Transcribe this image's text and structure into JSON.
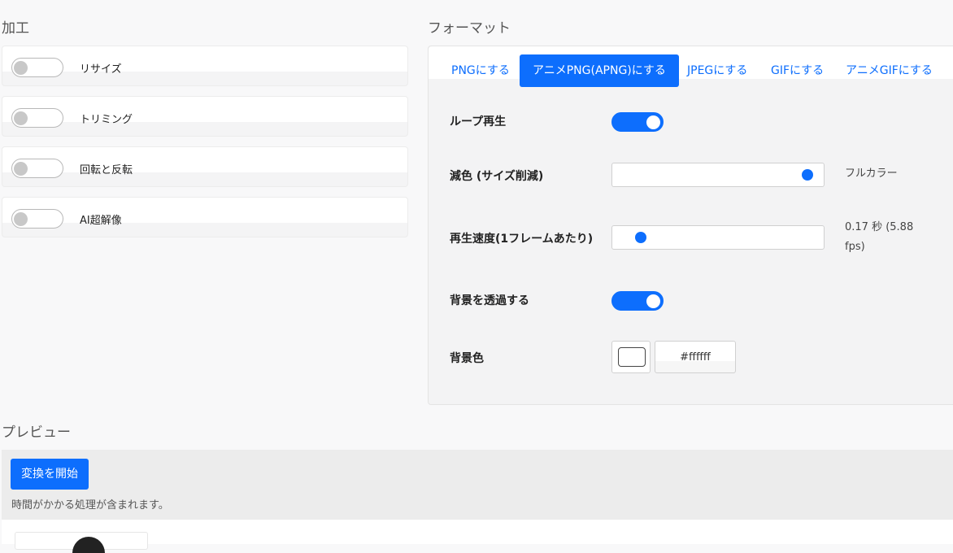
{
  "processing": {
    "title": "加工",
    "items": [
      {
        "label": "リサイズ",
        "enabled": false
      },
      {
        "label": "トリミング",
        "enabled": false
      },
      {
        "label": "回転と反転",
        "enabled": false
      },
      {
        "label": "AI超解像",
        "enabled": false
      }
    ]
  },
  "format": {
    "title": "フォーマット",
    "tabs": [
      {
        "label": "PNGにする",
        "active": false
      },
      {
        "label": "アニメPNG(APNG)にする",
        "active": true
      },
      {
        "label": "JPEGにする",
        "active": false
      },
      {
        "label": "GIFにする",
        "active": false
      },
      {
        "label": "アニメGIFにする",
        "active": false
      }
    ],
    "loop": {
      "label": "ループ再生",
      "enabled": true
    },
    "reduce_colors": {
      "label": "減色 (サイズ削減)",
      "value_text": "フルカラー",
      "level": 1.0
    },
    "speed": {
      "label": "再生速度(1フレームあたり)",
      "value_text": "0.17 秒 (5.88 fps)",
      "level": 0.07
    },
    "transparent": {
      "label": "背景を透過する",
      "enabled": true
    },
    "bg_color": {
      "label": "背景色",
      "value": "#ffffff"
    }
  },
  "preview": {
    "title": "プレビュー",
    "start_label": "変換を開始",
    "note": "時間がかかる処理が含まれます。"
  },
  "colors": {
    "accent": "#0d6efd"
  }
}
